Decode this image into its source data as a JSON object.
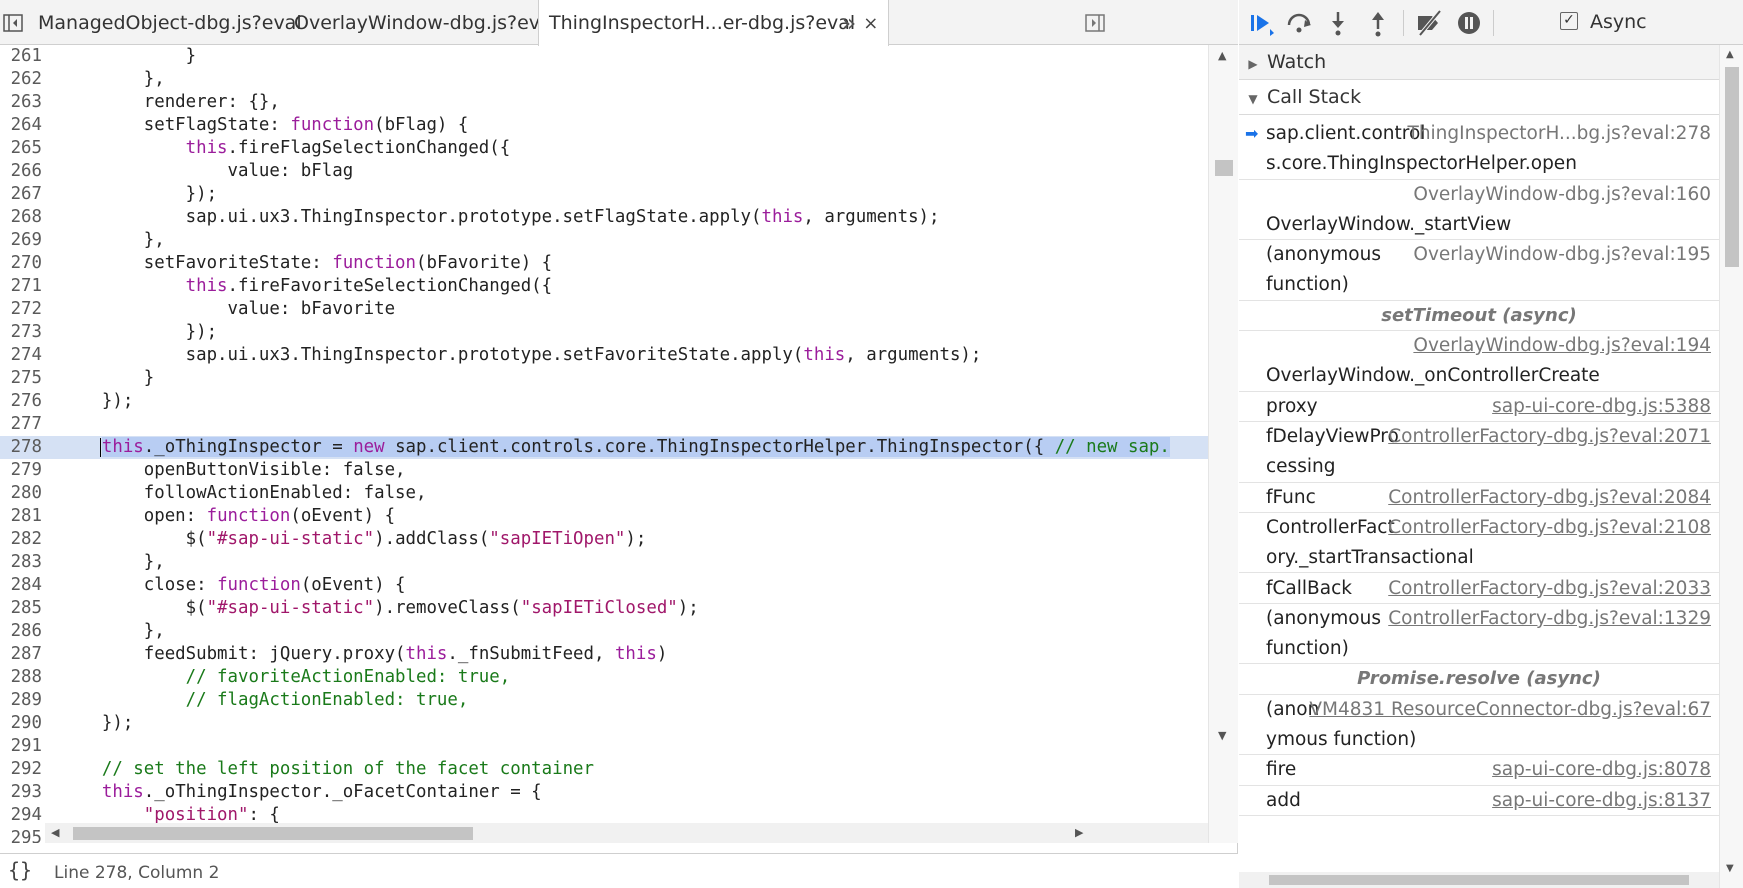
{
  "tabs": [
    {
      "label": "ManagedObject-dbg.js?eval",
      "active": false
    },
    {
      "label": "OverlayWindow-dbg.js?eval",
      "active": false
    },
    {
      "label": "ThingInspectorH...er-dbg.js?eval",
      "active": true
    }
  ],
  "tab_close": "×",
  "more_tabs": "»",
  "code_lines": [
    {
      "n": "261",
      "html": "            }"
    },
    {
      "n": "262",
      "html": "        },"
    },
    {
      "n": "263",
      "html": "        renderer: {},"
    },
    {
      "n": "264",
      "html": "        setFlagState: <span class=\"kw\">function</span>(bFlag) {"
    },
    {
      "n": "265",
      "html": "            <span class=\"kw\">this</span>.fireFlagSelectionChanged({"
    },
    {
      "n": "266",
      "html": "                value: bFlag"
    },
    {
      "n": "267",
      "html": "            });"
    },
    {
      "n": "268",
      "html": "            sap.ui.ux3.ThingInspector.prototype.setFlagState.apply(<span class=\"kw\">this</span>, arguments);"
    },
    {
      "n": "269",
      "html": "        },"
    },
    {
      "n": "270",
      "html": "        setFavoriteState: <span class=\"kw\">function</span>(bFavorite) {"
    },
    {
      "n": "271",
      "html": "            <span class=\"kw\">this</span>.fireFavoriteSelectionChanged({"
    },
    {
      "n": "272",
      "html": "                value: bFavorite"
    },
    {
      "n": "273",
      "html": "            });"
    },
    {
      "n": "274",
      "html": "            sap.ui.ux3.ThingInspector.prototype.setFavoriteState.apply(<span class=\"kw\">this</span>, arguments);"
    },
    {
      "n": "275",
      "html": "        }"
    },
    {
      "n": "276",
      "html": "    });"
    },
    {
      "n": "277",
      "html": ""
    },
    {
      "n": "278",
      "html": "    <span class=\"sel\"><span class=\"kw\">this</span>._oThingInspector = <span class=\"kw\">new</span> sap.client.controls.core.ThingInspectorHelper.ThingInspector({ <span class=\"com\">// new sap.</span></span>",
      "current": true
    },
    {
      "n": "279",
      "html": "        openButtonVisible: false,"
    },
    {
      "n": "280",
      "html": "        followActionEnabled: false,"
    },
    {
      "n": "281",
      "html": "        open: <span class=\"kw\">function</span>(oEvent) {"
    },
    {
      "n": "282",
      "html": "            $(<span class=\"str\">\"#sap-ui-static\"</span>).addClass(<span class=\"str\">\"sapIETiOpen\"</span>);"
    },
    {
      "n": "283",
      "html": "        },"
    },
    {
      "n": "284",
      "html": "        close: <span class=\"kw\">function</span>(oEvent) {"
    },
    {
      "n": "285",
      "html": "            $(<span class=\"str\">\"#sap-ui-static\"</span>).removeClass(<span class=\"str\">\"sapIETiClosed\"</span>);"
    },
    {
      "n": "286",
      "html": "        },"
    },
    {
      "n": "287",
      "html": "        feedSubmit: jQuery.proxy(<span class=\"kw\">this</span>._fnSubmitFeed, <span class=\"kw\">this</span>)"
    },
    {
      "n": "288",
      "html": "            <span class=\"com\">// favoriteActionEnabled: true,</span>"
    },
    {
      "n": "289",
      "html": "            <span class=\"com\">// flagActionEnabled: true,</span>"
    },
    {
      "n": "290",
      "html": "    });"
    },
    {
      "n": "291",
      "html": ""
    },
    {
      "n": "292",
      "html": "    <span class=\"com\">// set the left position of the facet container</span>"
    },
    {
      "n": "293",
      "html": "    <span class=\"kw\">this</span>._oThingInspector._oFacetContainer = {"
    },
    {
      "n": "294",
      "html": "        <span class=\"str\">\"position\"</span>: {"
    },
    {
      "n": "295",
      "html": ""
    }
  ],
  "status": {
    "format_icon": "{}",
    "position": "Line 278, Column 2"
  },
  "debugger": {
    "async_label": "Async",
    "async_checked": true,
    "watch_label": "Watch",
    "callstack_label": "Call Stack"
  },
  "call_stack": [
    {
      "kind": "frame",
      "name": "sap.client.control",
      "name2": "s.core.ThingInspectorHelper.open",
      "loc": "ThingInspectorH...bg.js?eval:278",
      "link": false,
      "current": true
    },
    {
      "kind": "frame",
      "name": "",
      "name2": "OverlayWindow._startView",
      "loc": "OverlayWindow-dbg.js?eval:160",
      "link": false
    },
    {
      "kind": "frame",
      "name": "(anonymous",
      "name2": "function)",
      "loc": "OverlayWindow-dbg.js?eval:195",
      "link": false
    },
    {
      "kind": "async",
      "label": "setTimeout (async)"
    },
    {
      "kind": "frame",
      "name": "",
      "name2": "OverlayWindow._onControllerCreate",
      "loc": "OverlayWindow-dbg.js?eval:194",
      "link": true
    },
    {
      "kind": "frame1",
      "name": "proxy",
      "loc": "sap-ui-core-dbg.js:5388",
      "link": true
    },
    {
      "kind": "frame",
      "name": "fDelayViewPro",
      "name2": "cessing",
      "loc": "ControllerFactory-dbg.js?eval:2071",
      "link": true
    },
    {
      "kind": "frame1",
      "name": "fFunc",
      "loc": "ControllerFactory-dbg.js?eval:2084",
      "link": true
    },
    {
      "kind": "frame",
      "name": "ControllerFact",
      "name2": "ory._startTransactional",
      "loc": "ControllerFactory-dbg.js?eval:2108",
      "link": true
    },
    {
      "kind": "frame1",
      "name": "fCallBack",
      "loc": "ControllerFactory-dbg.js?eval:2033",
      "link": true
    },
    {
      "kind": "frame",
      "name": "(anonymous",
      "name2": "function)",
      "loc": "ControllerFactory-dbg.js?eval:1329",
      "link": true
    },
    {
      "kind": "async",
      "label": "Promise.resolve (async)"
    },
    {
      "kind": "frame",
      "name": "(anon",
      "name2": "ymous function)",
      "loc": "VM4831 ResourceConnector-dbg.js?eval:67",
      "link": true
    },
    {
      "kind": "frame1",
      "name": "fire",
      "loc": "sap-ui-core-dbg.js:8078",
      "link": true
    },
    {
      "kind": "frame1",
      "name": "add",
      "loc": "sap-ui-core-dbg.js:8137",
      "link": true
    }
  ]
}
